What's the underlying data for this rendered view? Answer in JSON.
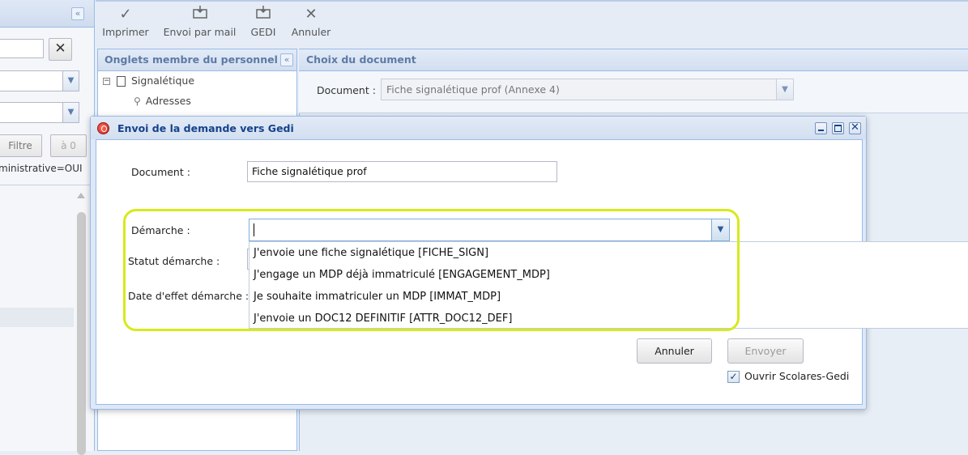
{
  "toolbar": {
    "items": [
      {
        "label": "Imprimer",
        "icon": "check-icon"
      },
      {
        "label": "Envoi par mail",
        "icon": "mail-icon"
      },
      {
        "label": "GEDI",
        "icon": "gedi-icon"
      },
      {
        "label": "Annuler",
        "icon": "close-icon"
      }
    ]
  },
  "left_panel": {
    "filter_button": "Filtre",
    "zero_button": "à 0",
    "filter_text": "ministrative=OUI"
  },
  "middle_panel": {
    "title": "Onglets membre du personnel",
    "tree": [
      {
        "label": "Signalétique"
      },
      {
        "label": "Adresses"
      }
    ]
  },
  "right_panel": {
    "title": "Choix du document",
    "document_label": "Document :",
    "document_value": "Fiche signalétique prof (Annexe 4)"
  },
  "dialog": {
    "title": "Envoi de la demande vers Gedi",
    "document_label": "Document :",
    "document_value": "Fiche signalétique prof",
    "demarche_label": "Démarche :",
    "demarche_value": "",
    "statut_label": "Statut démarche :",
    "date_label": "Date d'effet démarche :",
    "options": [
      "J'envoie une fiche signalétique [FICHE_SIGN]",
      "J'engage un MDP déjà immatriculé [ENGAGEMENT_MDP]",
      "Je souhaite immatriculer un MDP [IMMAT_MDP]",
      "J'envoie un DOC12 DEFINITIF [ATTR_DOC12_DEF]"
    ],
    "annuler_label": "Annuler",
    "envoyer_label": "Envoyer",
    "checkbox_label": "Ouvrir Scolares-Gedi",
    "checkbox_checked": true
  },
  "colors": {
    "panel_border": "#99bbe8",
    "dialog_title": "#15428b",
    "highlight": "#d7ea1b"
  }
}
